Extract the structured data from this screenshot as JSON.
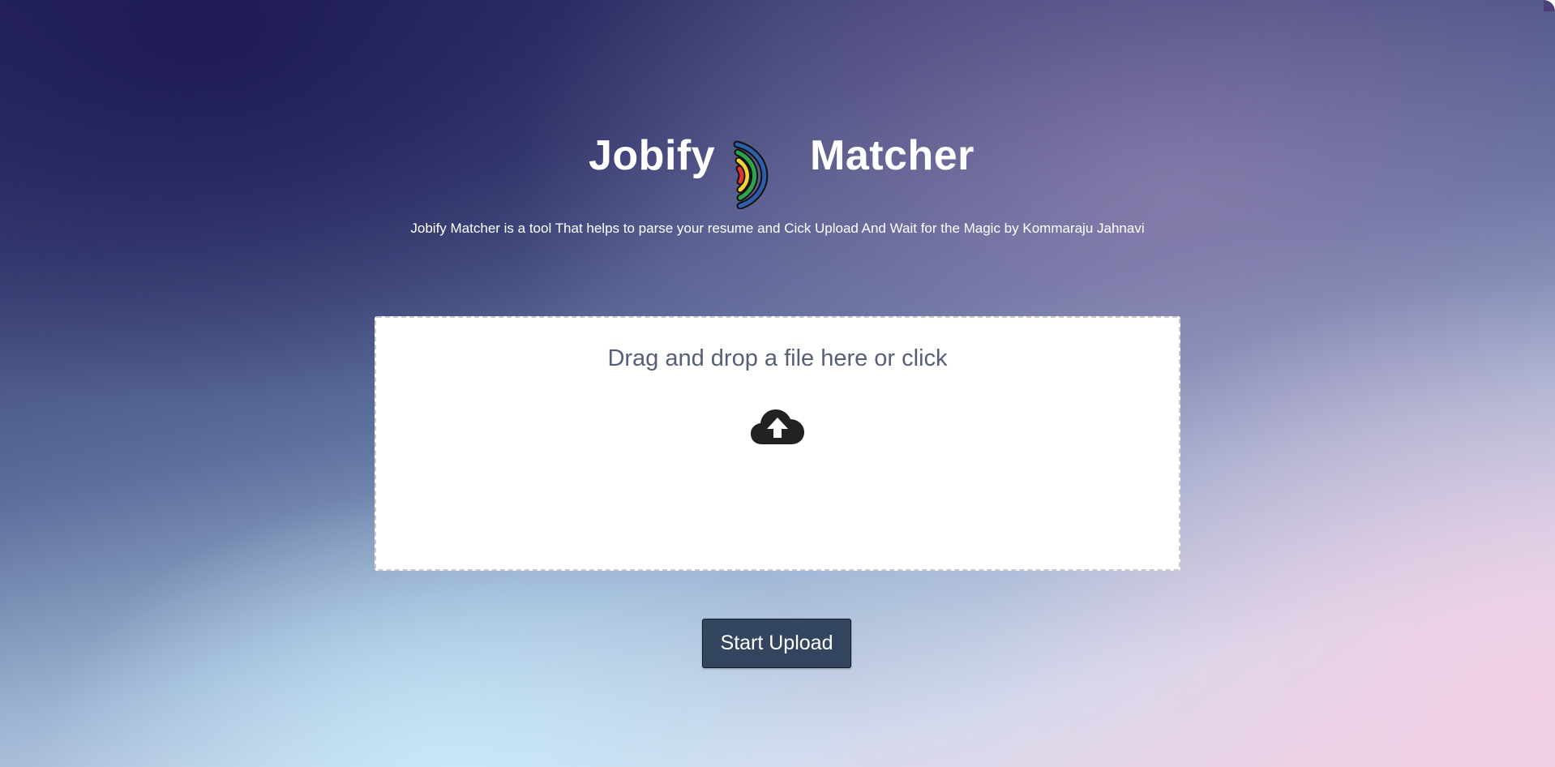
{
  "header": {
    "title_left": "Jobify",
    "title_right": "Matcher",
    "logo_icon": "rainbow-arc-icon",
    "subtitle": "Jobify Matcher is a tool That helps to parse your resume and Cick Upload And Wait for the Magic by Kommaraju Jahnavi"
  },
  "dropzone": {
    "text": "Drag and drop a file here or click",
    "icon": "cloud-upload-icon"
  },
  "actions": {
    "start_upload_label": "Start Upload"
  },
  "colors": {
    "button_bg": "#34465f",
    "title_text": "#ffffff",
    "drop_text": "#575f78"
  }
}
